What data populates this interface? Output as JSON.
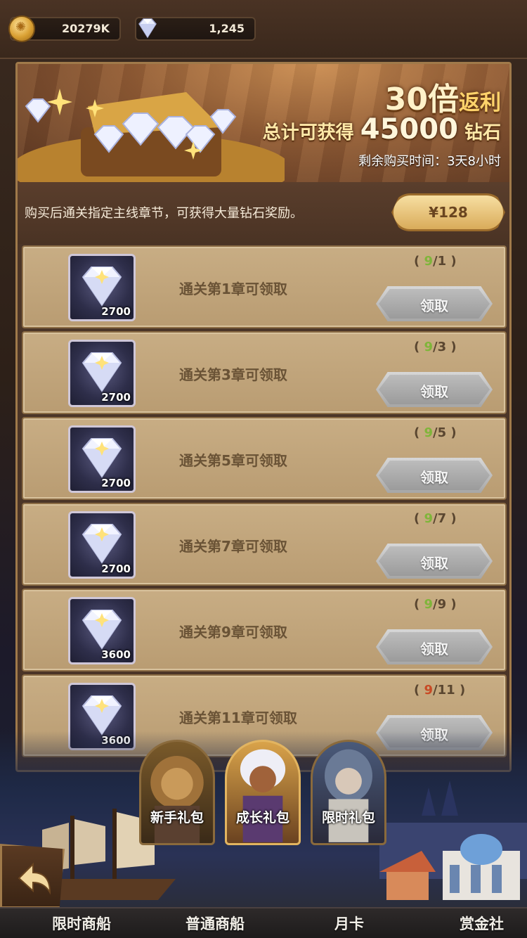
{
  "currency": {
    "gold": "20279K",
    "gems": "1,245",
    "gold_icon": "gold-coin-icon",
    "gem_icon": "diamond-icon"
  },
  "banner": {
    "multiplier_num": "30倍",
    "multiplier_text": "返利",
    "total_prefix": "总计可获得",
    "total_amount": "45000",
    "total_suffix": "钻石",
    "remaining_label": "剩余购买时间：",
    "remaining_time": "3天8小时"
  },
  "purchase": {
    "description": "购买后通关指定主线章节，可获得大量钻石奖励。",
    "price": "¥128"
  },
  "rewards": [
    {
      "label": "通关第1章可领取",
      "amount": "2700",
      "progress_current": "9",
      "progress_target": "1",
      "reached": true,
      "button": "领取"
    },
    {
      "label": "通关第3章可领取",
      "amount": "2700",
      "progress_current": "9",
      "progress_target": "3",
      "reached": true,
      "button": "领取"
    },
    {
      "label": "通关第5章可领取",
      "amount": "2700",
      "progress_current": "9",
      "progress_target": "5",
      "reached": true,
      "button": "领取"
    },
    {
      "label": "通关第7章可领取",
      "amount": "2700",
      "progress_current": "9",
      "progress_target": "7",
      "reached": true,
      "button": "领取"
    },
    {
      "label": "通关第9章可领取",
      "amount": "3600",
      "progress_current": "9",
      "progress_target": "9",
      "reached": true,
      "button": "领取"
    },
    {
      "label": "通关第11章可领取",
      "amount": "3600",
      "progress_current": "9",
      "progress_target": "11",
      "reached": false,
      "button": "领取"
    }
  ],
  "pack_tabs": {
    "new": "新手礼包",
    "growth": "成长礼包",
    "limited": "限时礼包"
  },
  "nav": {
    "limited_ship": "限时商船",
    "normal_ship": "普通商船",
    "monthly_card": "月卡",
    "bounty": "赏金社"
  },
  "colors": {
    "progress_ok": "#7fb53a",
    "progress_no": "#c84a25"
  }
}
